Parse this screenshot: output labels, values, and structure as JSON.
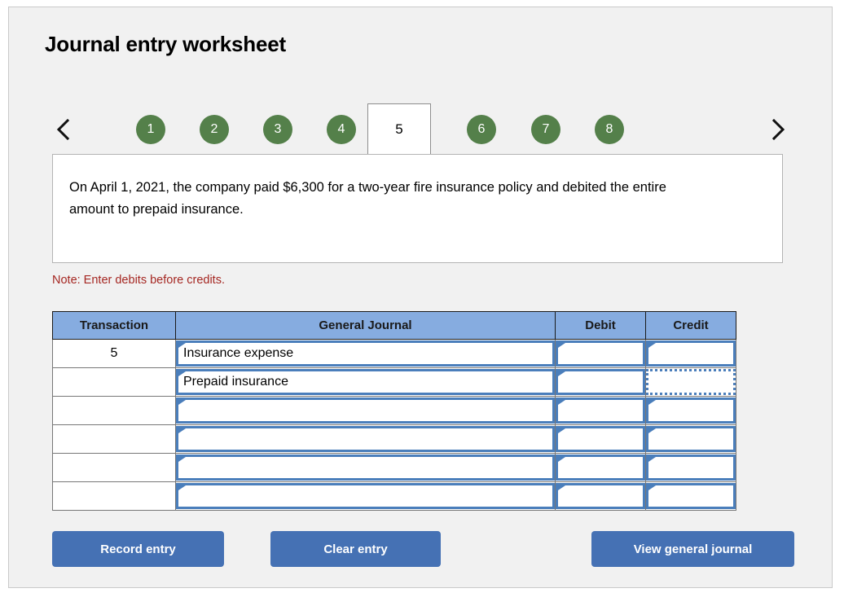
{
  "worksheet": {
    "title": "Journal entry worksheet",
    "nav": {
      "prev_icon": "chevron-left-icon",
      "next_icon": "chevron-right-icon"
    },
    "tabs": [
      {
        "label": "1",
        "active": false
      },
      {
        "label": "2",
        "active": false
      },
      {
        "label": "3",
        "active": false
      },
      {
        "label": "4",
        "active": false
      },
      {
        "label": "5",
        "active": true
      },
      {
        "label": "6",
        "active": false
      },
      {
        "label": "7",
        "active": false
      },
      {
        "label": "8",
        "active": false
      }
    ],
    "description": "On April 1, 2021, the company paid $6,300 for a two-year fire insurance policy and debited the entire amount to prepaid insurance.",
    "note": "Note: Enter debits before credits."
  },
  "table": {
    "headers": {
      "transaction": "Transaction",
      "general_journal": "General Journal",
      "debit": "Debit",
      "credit": "Credit"
    },
    "rows": [
      {
        "transaction": "5",
        "general_journal": "Insurance expense",
        "debit": "",
        "credit": "",
        "credit_selected": false
      },
      {
        "transaction": "",
        "general_journal": "Prepaid insurance",
        "debit": "",
        "credit": "",
        "credit_selected": true
      },
      {
        "transaction": "",
        "general_journal": "",
        "debit": "",
        "credit": "",
        "credit_selected": false
      },
      {
        "transaction": "",
        "general_journal": "",
        "debit": "",
        "credit": "",
        "credit_selected": false
      },
      {
        "transaction": "",
        "general_journal": "",
        "debit": "",
        "credit": "",
        "credit_selected": false
      },
      {
        "transaction": "",
        "general_journal": "",
        "debit": "",
        "credit": "",
        "credit_selected": false
      }
    ]
  },
  "buttons": {
    "record": "Record entry",
    "clear": "Clear entry",
    "view": "View general journal"
  },
  "colors": {
    "tab_green": "#54804a",
    "table_header_blue": "#86ace0",
    "button_blue": "#4571b4",
    "note_red": "#a52722",
    "dropdown_blue": "#4a7ebb",
    "panel_bg": "#f1f1f1"
  }
}
